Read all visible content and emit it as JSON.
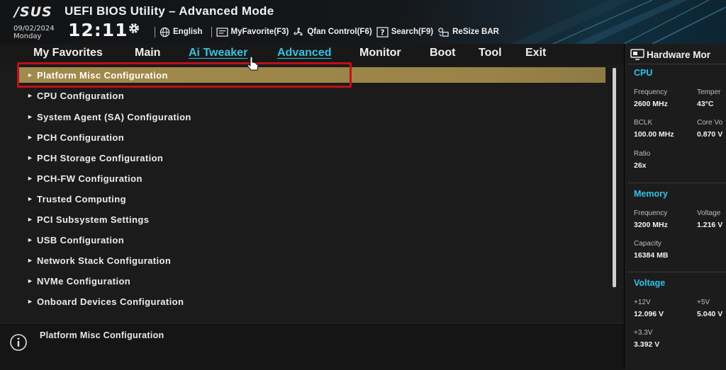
{
  "header": {
    "logo": "/SUS",
    "title": "UEFI BIOS Utility – Advanced Mode",
    "date": "09/02/2024",
    "day": "Monday",
    "time": "12:11",
    "toolbar": [
      {
        "label": "English",
        "icon": "globe-icon"
      },
      {
        "label": "MyFavorite(F3)",
        "icon": "favorite-icon"
      },
      {
        "label": "Qfan Control(F6)",
        "icon": "fan-icon"
      },
      {
        "label": "Search(F9)",
        "icon": "search-icon"
      },
      {
        "label": "ReSize BAR",
        "icon": "resize-bar-icon"
      }
    ]
  },
  "tabs": [
    {
      "label": "My Favorites"
    },
    {
      "label": "Main"
    },
    {
      "label": "Ai Tweaker"
    },
    {
      "label": "Advanced"
    },
    {
      "label": "Monitor"
    },
    {
      "label": "Boot"
    },
    {
      "label": "Tool"
    },
    {
      "label": "Exit"
    }
  ],
  "menu": [
    {
      "label": "Platform Misc Configuration"
    },
    {
      "label": "CPU Configuration"
    },
    {
      "label": "System Agent (SA) Configuration"
    },
    {
      "label": "PCH Configuration"
    },
    {
      "label": "PCH Storage Configuration"
    },
    {
      "label": "PCH-FW Configuration"
    },
    {
      "label": "Trusted Computing"
    },
    {
      "label": "PCI Subsystem Settings"
    },
    {
      "label": "USB Configuration"
    },
    {
      "label": "Network Stack Configuration"
    },
    {
      "label": "NVMe Configuration"
    },
    {
      "label": "Onboard Devices Configuration"
    }
  ],
  "help": {
    "text": "Platform Misc Configuration"
  },
  "hwm": {
    "title": "Hardware Mor",
    "cpu": {
      "section": "CPU",
      "frequency_label": "Frequency",
      "frequency_value": "2600 MHz",
      "temp_label": "Temper",
      "temp_value": "43°C",
      "bclk_label": "BCLK",
      "bclk_value": "100.00 MHz",
      "corev_label": "Core Vo",
      "corev_value": "0.870 V",
      "ratio_label": "Ratio",
      "ratio_value": "26x"
    },
    "memory": {
      "section": "Memory",
      "frequency_label": "Frequency",
      "frequency_value": "3200 MHz",
      "voltage_label": "Voltage",
      "voltage_value": "1.216 V",
      "capacity_label": "Capacity",
      "capacity_value": "16384 MB"
    },
    "voltage": {
      "section": "Voltage",
      "v12_label": "+12V",
      "v12_value": "12.096 V",
      "v5_label": "+5V",
      "v5_value": "5.040 V",
      "v33_label": "+3.3V",
      "v33_value": "3.392 V"
    }
  },
  "colors": {
    "accent": "#37c2df",
    "selected": "#a28a4d",
    "highlight_box": "#c0101a"
  }
}
